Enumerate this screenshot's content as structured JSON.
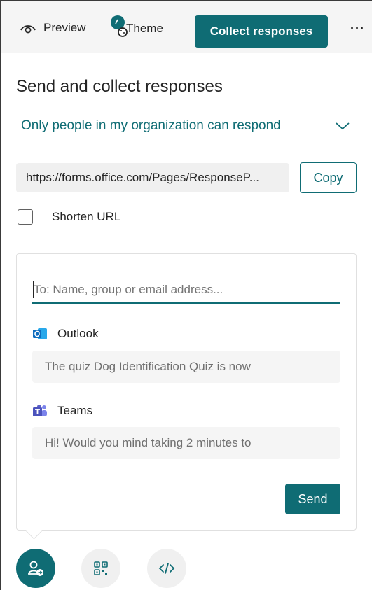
{
  "toolbar": {
    "preview_label": "Preview",
    "theme_label": "Theme",
    "collect_label": "Collect responses",
    "more_label": "···"
  },
  "panel": {
    "title": "Send and collect responses",
    "audience": "Only people in my organization can respond",
    "url": "https://forms.office.com/Pages/ResponseP...",
    "copy_label": "Copy",
    "shorten_label": "Shorten URL",
    "shorten_checked": false
  },
  "share": {
    "to_placeholder": "To: Name, group or email address...",
    "outlook": {
      "label": "Outlook",
      "message": "The quiz Dog Identification Quiz is now"
    },
    "teams": {
      "label": "Teams",
      "message": "Hi! Would you mind taking 2 minutes to"
    },
    "send_label": "Send"
  },
  "methods": [
    {
      "name": "link-share-icon",
      "selected": true
    },
    {
      "name": "qr-code-icon",
      "selected": false
    },
    {
      "name": "embed-code-icon",
      "selected": false
    }
  ],
  "colors": {
    "accent": "#0f6c74",
    "outlook_blue": "#0f6cbd",
    "teams_purple": "#5b5fc7"
  }
}
